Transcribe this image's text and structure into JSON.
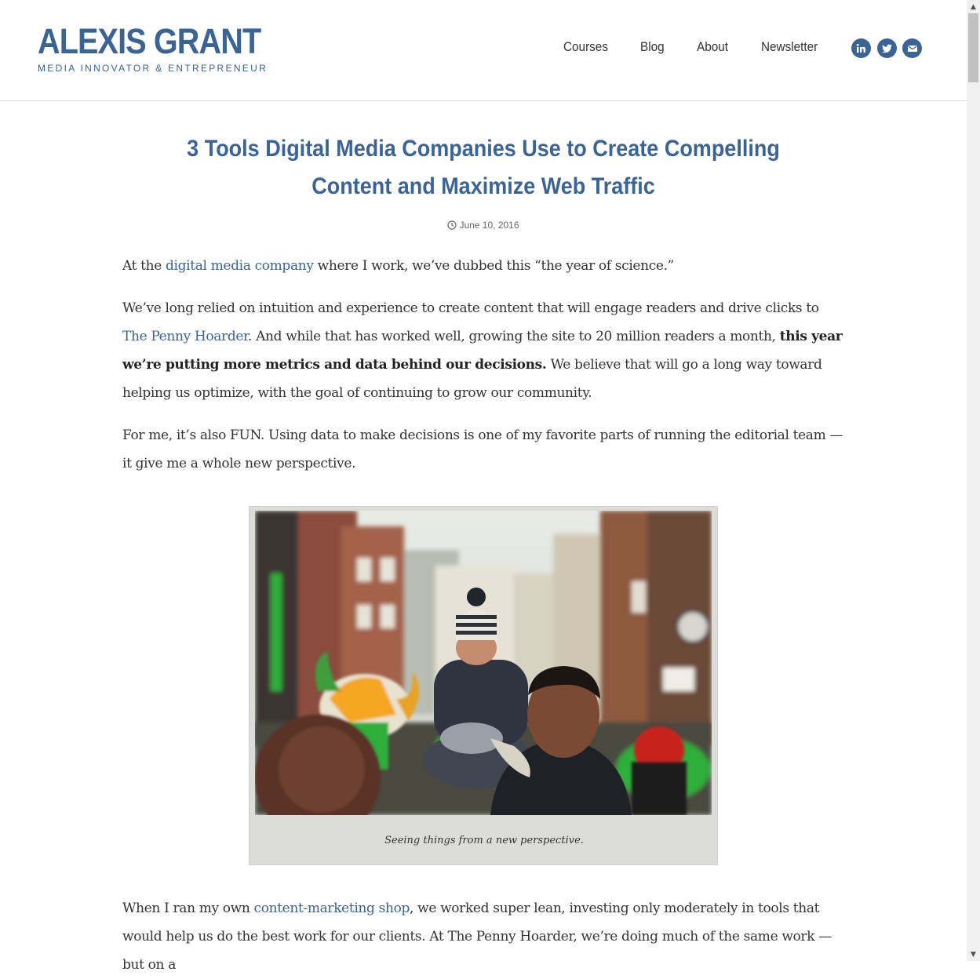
{
  "site": {
    "name": "ALEXIS GRANT",
    "tagline": "MEDIA INNOVATOR & ENTREPRENEUR"
  },
  "nav": {
    "items": [
      "Courses",
      "Blog",
      "About",
      "Newsletter"
    ]
  },
  "social": {
    "icons": [
      "linkedin-icon",
      "twitter-icon",
      "email-icon"
    ]
  },
  "colors": {
    "brand": "#3a6496",
    "text": "#333333",
    "figure_bg": "#dcddd8"
  },
  "article": {
    "title": "3 Tools Digital Media Companies Use to Create Compelling Content and Maximize Web Traffic",
    "date": "June 10, 2016",
    "p1": {
      "a": "At the ",
      "link": "digital media company",
      "b": " where I work, we’ve dubbed this “the year of science.”"
    },
    "p2": {
      "a": "We’ve long relied on intuition and experience to create content that will engage readers and drive clicks to ",
      "link": "The Penny Hoarder",
      "b": ". And while that has worked well, growing the site to 20 million readers a month, ",
      "bold": "this year we’re putting more metrics and data behind our decisions.",
      "c": " We believe that will go a long way toward helping us optimize, with the goal of continuing to grow our community."
    },
    "p3": "For me, it’s also FUN. Using data to make decisions is one of my favorite parts of running the editorial team — it give me a whole new perspective.",
    "figure": {
      "caption": "Seeing things from a new perspective."
    },
    "p4": {
      "a": "When I ran my own ",
      "link": "content-marketing shop",
      "b": ", we worked super lean, investing only moderately in tools that would help us do the best work for our clients. At The Penny Hoarder, we’re doing much of the same work — but on a"
    }
  }
}
